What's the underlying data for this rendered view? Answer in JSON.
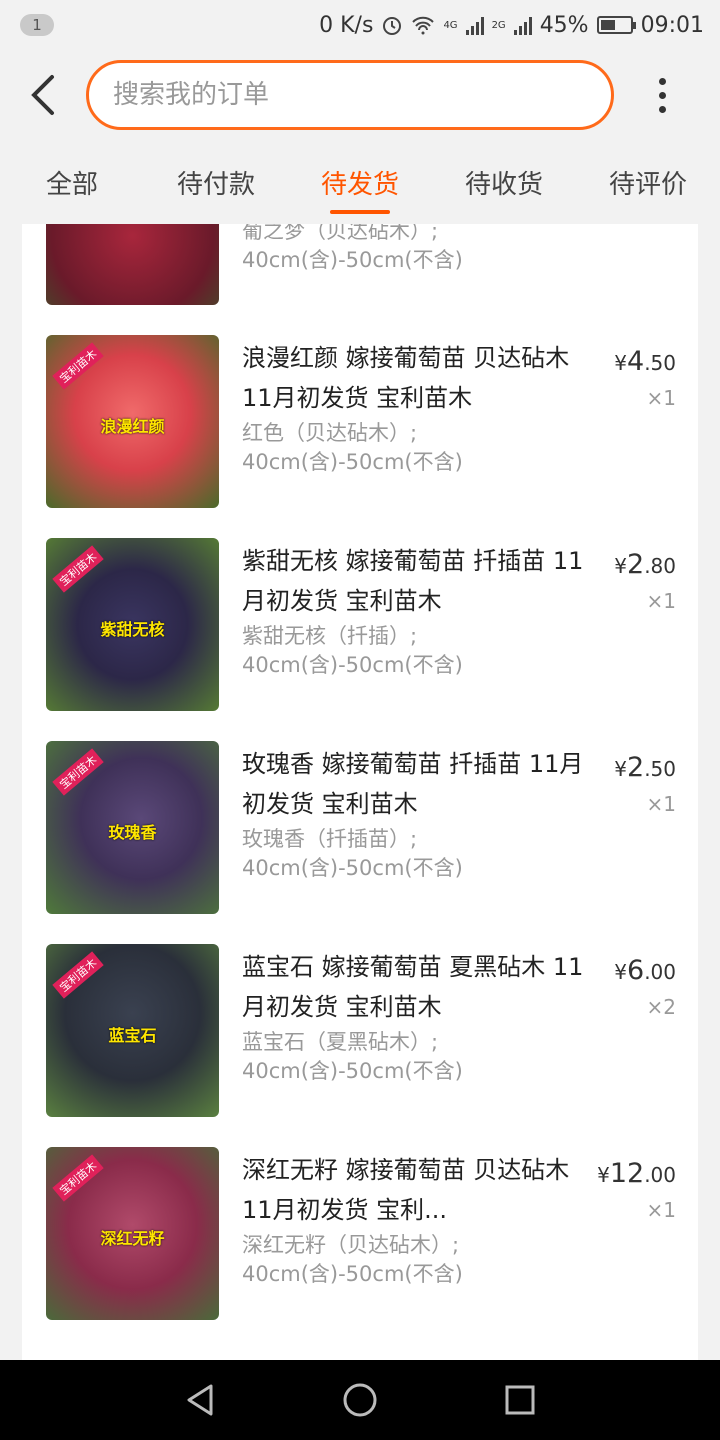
{
  "status_bar": {
    "notification_count": "1",
    "net_speed": "0 K/s",
    "battery": "45%",
    "time": "09:01",
    "net1": "4G",
    "net2": "2G"
  },
  "search": {
    "placeholder": "搜索我的订单"
  },
  "tabs": [
    {
      "label": "全部"
    },
    {
      "label": "待付款"
    },
    {
      "label": "待发货"
    },
    {
      "label": "待收货"
    },
    {
      "label": "待评价"
    }
  ],
  "items": [
    {
      "title": "",
      "sku_line1": "葡之梦（贝达砧木）;",
      "sku_line2": "40cm(含)-50cm(不含)",
      "thumb_label": "",
      "thumb_color": "#6a1a2a"
    },
    {
      "title": "浪漫红颜 嫁接葡萄苗 贝达砧木 11月初发货  宝利苗木",
      "sku_line1": "红色（贝达砧木）;",
      "sku_line2": "40cm(含)-50cm(不含)",
      "price_symbol": "¥",
      "price_int": "4",
      "price_dec": ".50",
      "qty": "×1",
      "thumb_label": "浪漫红颜",
      "thumb_color": "#d8414a"
    },
    {
      "title": "紫甜无核 嫁接葡萄苗 扦插苗 11月初发货  宝利苗木",
      "sku_line1": "紫甜无核（扦插）;",
      "sku_line2": "40cm(含)-50cm(不含)",
      "price_symbol": "¥",
      "price_int": "2",
      "price_dec": ".80",
      "qty": "×1",
      "thumb_label": "紫甜无核",
      "thumb_color": "#2c2748"
    },
    {
      "title": "玫瑰香 嫁接葡萄苗 扦插苗 11月初发货  宝利苗木",
      "sku_line1": "玫瑰香（扦插苗）;",
      "sku_line2": "40cm(含)-50cm(不含)",
      "price_symbol": "¥",
      "price_int": "2",
      "price_dec": ".50",
      "qty": "×1",
      "thumb_label": "玫瑰香",
      "thumb_color": "#3f3158"
    },
    {
      "title": "蓝宝石 嫁接葡萄苗 夏黑砧木 11月初发货  宝利苗木",
      "sku_line1": "蓝宝石（夏黑砧木）;",
      "sku_line2": "40cm(含)-50cm(不含)",
      "price_symbol": "¥",
      "price_int": "6",
      "price_dec": ".00",
      "qty": "×2",
      "thumb_label": "蓝宝石",
      "thumb_color": "#2a2f3a"
    },
    {
      "title": "深红无籽 嫁接葡萄苗 贝达砧木 11月初发货  宝利...",
      "sku_line1": "深红无籽（贝达砧木）;",
      "sku_line2": "40cm(含)-50cm(不含)",
      "price_symbol": "¥",
      "price_int": "12",
      "price_dec": ".00",
      "qty": "×1",
      "thumb_label": "深红无籽",
      "thumb_color": "#8a2b4a"
    }
  ],
  "colors": {
    "accent": "#ff5500",
    "search_border": "#ff6a1a"
  }
}
